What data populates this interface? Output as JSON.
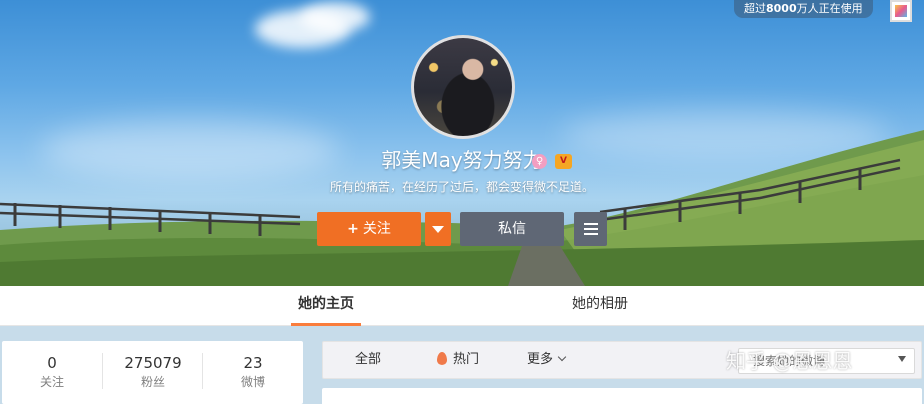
{
  "header": {
    "usage_badge_prefix": "超过",
    "usage_badge_number": "8000",
    "usage_badge_suffix": "万人正在使用"
  },
  "profile": {
    "name": "郭美May努力努力",
    "bio": "所有的痛苦，在经历了过后，都会变得微不足道。",
    "gender_icon": "female-icon",
    "vip_icon": "vip-badge-icon"
  },
  "actions": {
    "follow_label": "关注",
    "message_label": "私信"
  },
  "tabs": [
    {
      "label": "她的主页",
      "active": true
    },
    {
      "label": "她的相册",
      "active": false
    }
  ],
  "stats": [
    {
      "value": "0",
      "label": "关注"
    },
    {
      "value": "275079",
      "label": "粉丝"
    },
    {
      "value": "23",
      "label": "微博"
    }
  ],
  "feed_filter": {
    "all_label": "全部",
    "hot_label": "热门",
    "more_label": "更多",
    "search_placeholder": "搜索她的微博"
  },
  "watermark": "知乎 @恩恩恩",
  "colors": {
    "accent_orange": "#f06f24",
    "button_gray": "#5f6775",
    "tab_underline": "#fa7d3c"
  }
}
